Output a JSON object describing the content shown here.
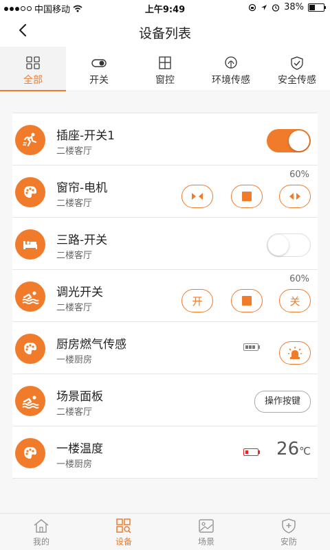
{
  "status_bar": {
    "carrier": "中国移动",
    "time": "上午9:49",
    "battery": "38%"
  },
  "nav": {
    "title": "设备列表"
  },
  "tabs": [
    {
      "label": "全部",
      "icon": "grid-icon",
      "active": true
    },
    {
      "label": "开关",
      "icon": "toggle-icon",
      "active": false
    },
    {
      "label": "窗控",
      "icon": "window-icon",
      "active": false
    },
    {
      "label": "环境传感",
      "icon": "environment-icon",
      "active": false
    },
    {
      "label": "安全传感",
      "icon": "shield-check-icon",
      "active": false
    }
  ],
  "devices": [
    {
      "name": "插座-开关1",
      "location": "二楼客厅",
      "icon": "runner-icon",
      "control": "toggle",
      "state": "on"
    },
    {
      "name": "窗帘-电机",
      "location": "二楼客厅",
      "icon": "palette-icon",
      "control": "curtain",
      "percent": "60%"
    },
    {
      "name": "三路-开关",
      "location": "二楼客厅",
      "icon": "bed-icon",
      "control": "toggle",
      "state": "off"
    },
    {
      "name": "调光开关",
      "location": "二楼客厅",
      "icon": "swimmer-icon",
      "control": "dimmer",
      "percent": "60%",
      "on_label": "开",
      "off_label": "关"
    },
    {
      "name": "厨房燃气传感",
      "location": "一楼厨房",
      "icon": "palette-icon",
      "control": "sensor",
      "battery_level": 0.75
    },
    {
      "name": "场景面板",
      "location": "二楼客厅",
      "icon": "swimmer-icon",
      "control": "scene",
      "button_label": "操作按键"
    },
    {
      "name": "一楼温度",
      "location": "一楼厨房",
      "icon": "palette-icon",
      "control": "temperature",
      "temperature": "26",
      "unit": "℃",
      "battery_level": 0.1
    }
  ],
  "bottom_tabs": [
    {
      "label": "我的",
      "icon": "home-icon",
      "active": false
    },
    {
      "label": "设备",
      "icon": "device-search-icon",
      "active": true
    },
    {
      "label": "场景",
      "icon": "image-icon",
      "active": false
    },
    {
      "label": "安防",
      "icon": "shield-plus-icon",
      "active": false
    }
  ],
  "colors": {
    "accent": "#f07b2a",
    "alarm_battery": "#e22222"
  }
}
